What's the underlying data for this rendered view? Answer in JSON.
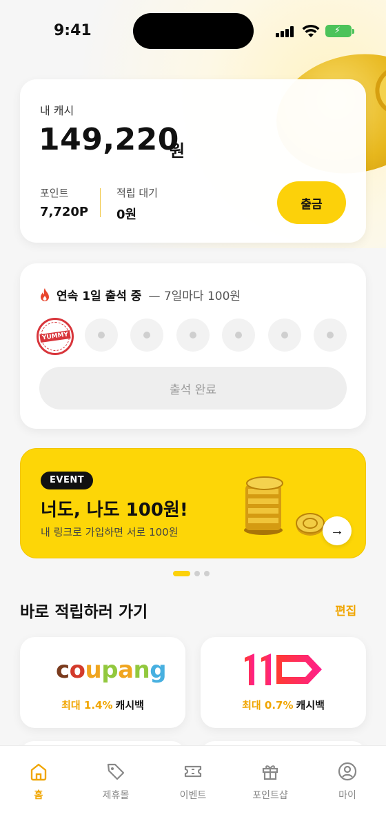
{
  "status_bar": {
    "time": "9:41"
  },
  "cash_card": {
    "label": "내 캐시",
    "amount": "149,220",
    "unit": "원",
    "points_label": "포인트",
    "points_value": "7,720P",
    "pending_label": "적립 대기",
    "pending_value": "0원",
    "withdraw_label": "출금"
  },
  "attendance": {
    "title": "연속 1일 출석 중",
    "subtitle": "— 7일마다 100원",
    "stamp_text": "YUMMY",
    "days_checked": 1,
    "days_total": 7,
    "button_label": "출석 완료"
  },
  "event_banner": {
    "badge": "EVENT",
    "title": "너도, 나도 100원!",
    "subtitle": "내 링크로 가입하면 서로 100원",
    "arrow": "→",
    "page_current": 1,
    "page_total": 3
  },
  "shortcuts": {
    "title": "바로 적립하러 가기",
    "edit_label": "편집",
    "shops": [
      {
        "name": "coupang",
        "rate": "최대 1.4%",
        "suffix": "캐시백"
      },
      {
        "name": "11",
        "rate": "최대 0.7%",
        "suffix": "캐시백"
      }
    ]
  },
  "tabbar": {
    "items": [
      {
        "label": "홈",
        "icon": "home-icon",
        "active": true
      },
      {
        "label": "제휴몰",
        "icon": "tag-icon",
        "active": false
      },
      {
        "label": "이벤트",
        "icon": "ticket-icon",
        "active": false
      },
      {
        "label": "포인트샵",
        "icon": "gift-icon",
        "active": false
      },
      {
        "label": "마이",
        "icon": "user-icon",
        "active": false
      }
    ]
  },
  "colors": {
    "accent": "#fcd10a",
    "highlight": "#f0a500",
    "stamp": "#d8353b"
  }
}
